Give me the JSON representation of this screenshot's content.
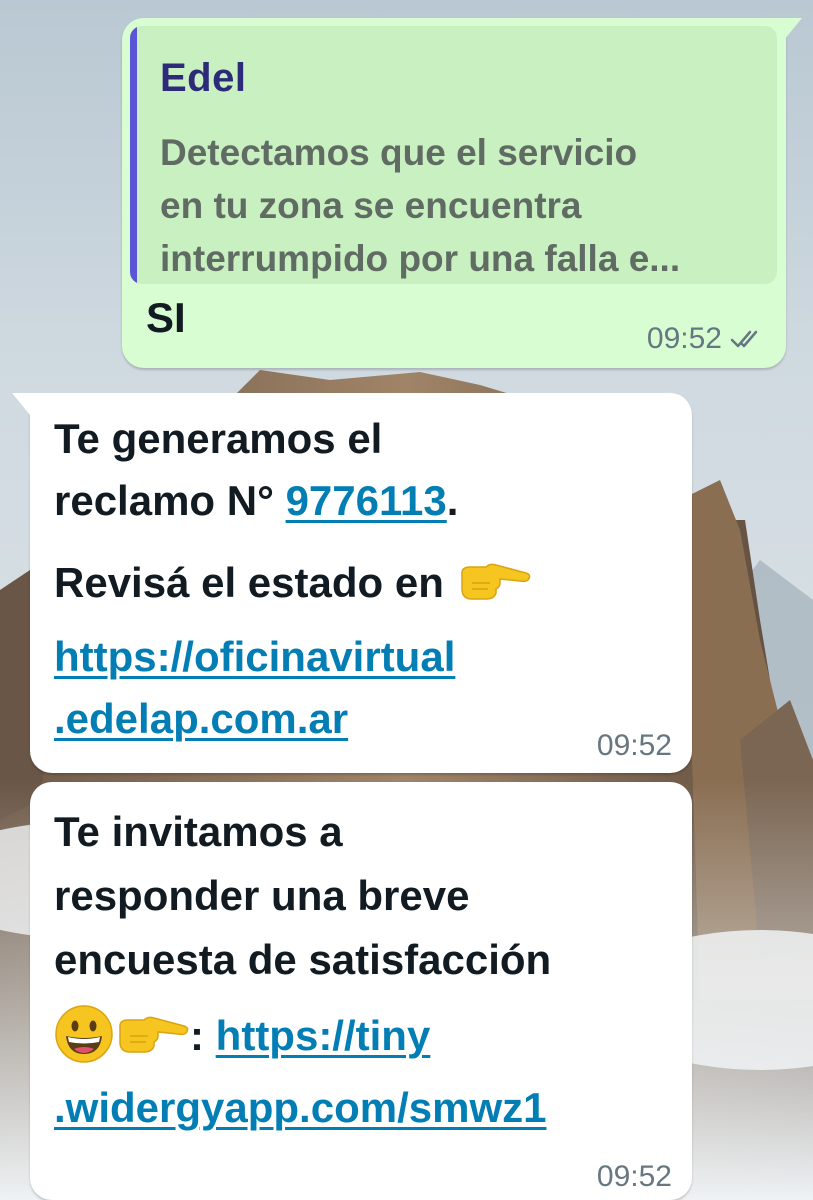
{
  "outgoing": {
    "quote": {
      "author": "Edel",
      "line1": "Detectamos que el servicio",
      "line2": "en tu zona se encuentra",
      "line3": "interrumpido por una falla e..."
    },
    "text": "SI",
    "time": "09:52",
    "status_icon": "double-check-icon"
  },
  "messages": [
    {
      "line1": "Te generamos el",
      "line2_prefix": "reclamo N° ",
      "claim_number": "9776113",
      "line2_suffix": ".",
      "line3": "Revisá el estado en",
      "line3_emoji": "pointing-right-emoji",
      "link_part1": "https://oficinavirtual",
      "link_part2": ".edelap.com.ar",
      "time": "09:52"
    },
    {
      "line1": "Te invitamos a",
      "line2": "responder una breve",
      "line3": "encuesta de satisfacción",
      "line4_emojis": [
        "grinning-face-emoji",
        "pointing-right-emoji"
      ],
      "line4_colon": ":",
      "link_part1": "https://tiny",
      "link_part2": ".widergyapp.com/smwz1",
      "time": "09:52"
    }
  ],
  "colors": {
    "outgoing_bubble": "#d9fdd3",
    "incoming_bubble": "#ffffff",
    "quote_bar": "#5a55d6",
    "link": "#027eb5"
  }
}
